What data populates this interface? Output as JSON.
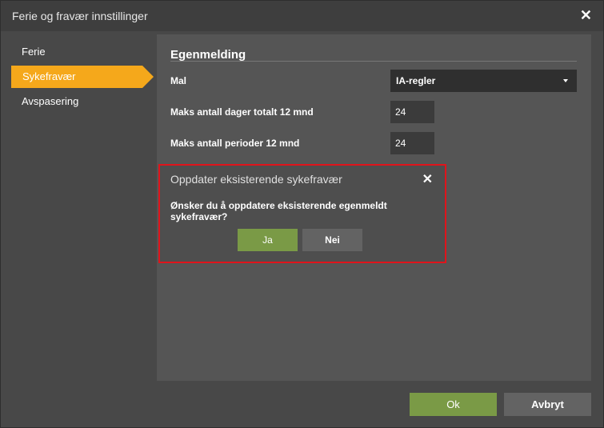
{
  "window": {
    "title": "Ferie og fravær innstillinger"
  },
  "sidebar": {
    "items": [
      {
        "label": "Ferie"
      },
      {
        "label": "Sykefravær",
        "active": true
      },
      {
        "label": "Avspasering"
      }
    ]
  },
  "panel": {
    "section_title": "Egenmelding",
    "rows": [
      {
        "label": "Mal",
        "value": "IA-regler"
      },
      {
        "label": "Maks antall dager totalt 12 mnd",
        "value": "24"
      },
      {
        "label": "Maks antall perioder 12 mnd",
        "value": "24"
      }
    ]
  },
  "dialog": {
    "title": "Oppdater eksisterende sykefravær",
    "message": "Ønsker du å oppdatere eksisterende egenmeldt sykefravær?",
    "yes_label": "Ja",
    "no_label": "Nei"
  },
  "footer": {
    "ok_label": "Ok",
    "cancel_label": "Avbryt"
  },
  "colors": {
    "accent": "#f5a81b",
    "primary_button": "#7a9a46",
    "highlight_border": "#e0141b"
  }
}
